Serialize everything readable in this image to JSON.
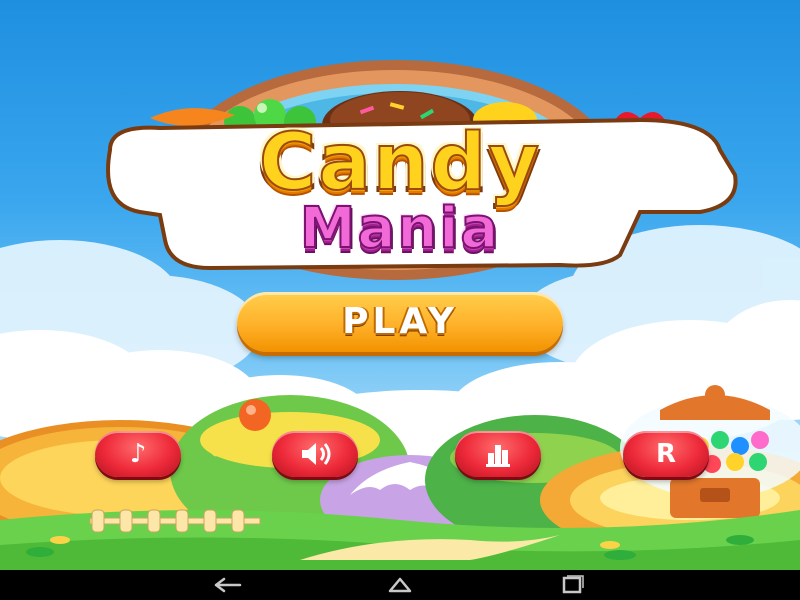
{
  "title": {
    "line1": "Candy",
    "line2": "Mania"
  },
  "play_button": {
    "label": "PLAY"
  },
  "round_buttons": [
    {
      "name": "music-button",
      "icon": "music-note-icon",
      "glyph": "♪"
    },
    {
      "name": "sound-button",
      "icon": "speaker-icon",
      "glyph": ""
    },
    {
      "name": "leaderboard-button",
      "icon": "leaderboard-icon",
      "glyph": ""
    },
    {
      "name": "rate-button",
      "icon": "rate-icon",
      "glyph": "R"
    }
  ],
  "navbar": {
    "buttons": [
      {
        "name": "back-nav-button",
        "icon": "back-arrow-icon"
      },
      {
        "name": "home-nav-button",
        "icon": "home-icon"
      },
      {
        "name": "recents-nav-button",
        "icon": "recent-apps-icon"
      }
    ]
  },
  "colors": {
    "sky_top": "#1e8fe0",
    "play_button": "#ffb12a",
    "round_button": "#ee2a3a",
    "title_yellow": "#ffd21e",
    "title_pink": "#f26ad8"
  }
}
